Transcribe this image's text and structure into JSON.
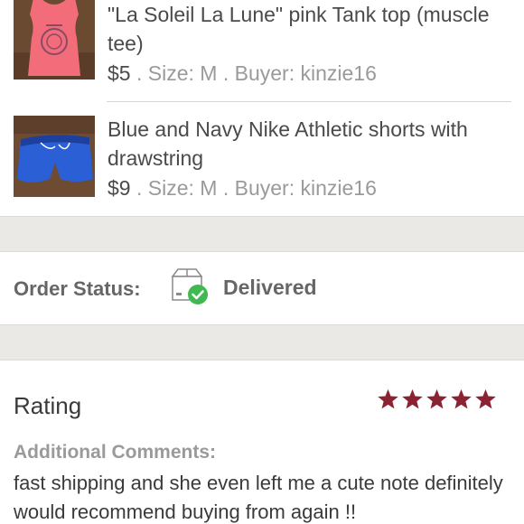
{
  "items": [
    {
      "title": "\"La Soleil La Lune\" pink Tank top (muscle tee)",
      "price": "$5",
      "meta": " . Size: M . Buyer: kinzie16",
      "thumbnail_icon": "pink-tank-top-photo"
    },
    {
      "title": "Blue and Navy Nike Athletic shorts with drawstring",
      "price": "$9",
      "meta": " . Size: M . Buyer: kinzie16",
      "thumbnail_icon": "blue-shorts-photo"
    }
  ],
  "order_status": {
    "label": "Order Status:",
    "value": "Delivered",
    "icon": "delivered-box-check-icon",
    "check_color": "#3fb950"
  },
  "rating": {
    "label": "Rating",
    "stars": 5,
    "max_stars": 5,
    "star_color": "#8b2332",
    "comments_label": "Additional Comments:",
    "comments": "fast shipping and she even left me a cute note definitely would recommend buying from again !!"
  }
}
